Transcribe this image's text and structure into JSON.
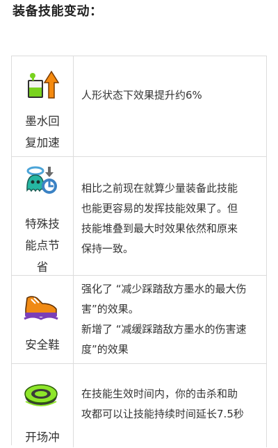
{
  "heading": "装备技能变动：",
  "skills": [
    {
      "icon": "ink-recovery-icon",
      "name_lines": [
        "墨水回",
        "复加速"
      ],
      "desc": [
        "人形状态下效果提升约6%"
      ]
    },
    {
      "icon": "special-saver-icon",
      "name_lines": [
        "特殊技",
        "能点节",
        "省"
      ],
      "desc": [
        "相比之前现在就算少量装备此技能",
        "也能更容易的发挥技能效果了。但",
        "技能堆叠到最大时效果依然和原来",
        "保持一致。"
      ]
    },
    {
      "icon": "safety-shoes-icon",
      "name_lines": [
        "安全鞋"
      ],
      "desc": [
        "强化了 “减少踩踏敌方墨水的最大伤",
        "害”的效果。",
        "新增了 “减缓踩踏敌方墨水的伤害速",
        "度”的效果"
      ]
    },
    {
      "icon": "opening-gambit-icon",
      "name_lines": [
        "开场冲"
      ],
      "desc": [
        "在技能生效时间内，你的击杀和助",
        "攻都可以让技能持续时间延长7.5秒"
      ]
    }
  ]
}
